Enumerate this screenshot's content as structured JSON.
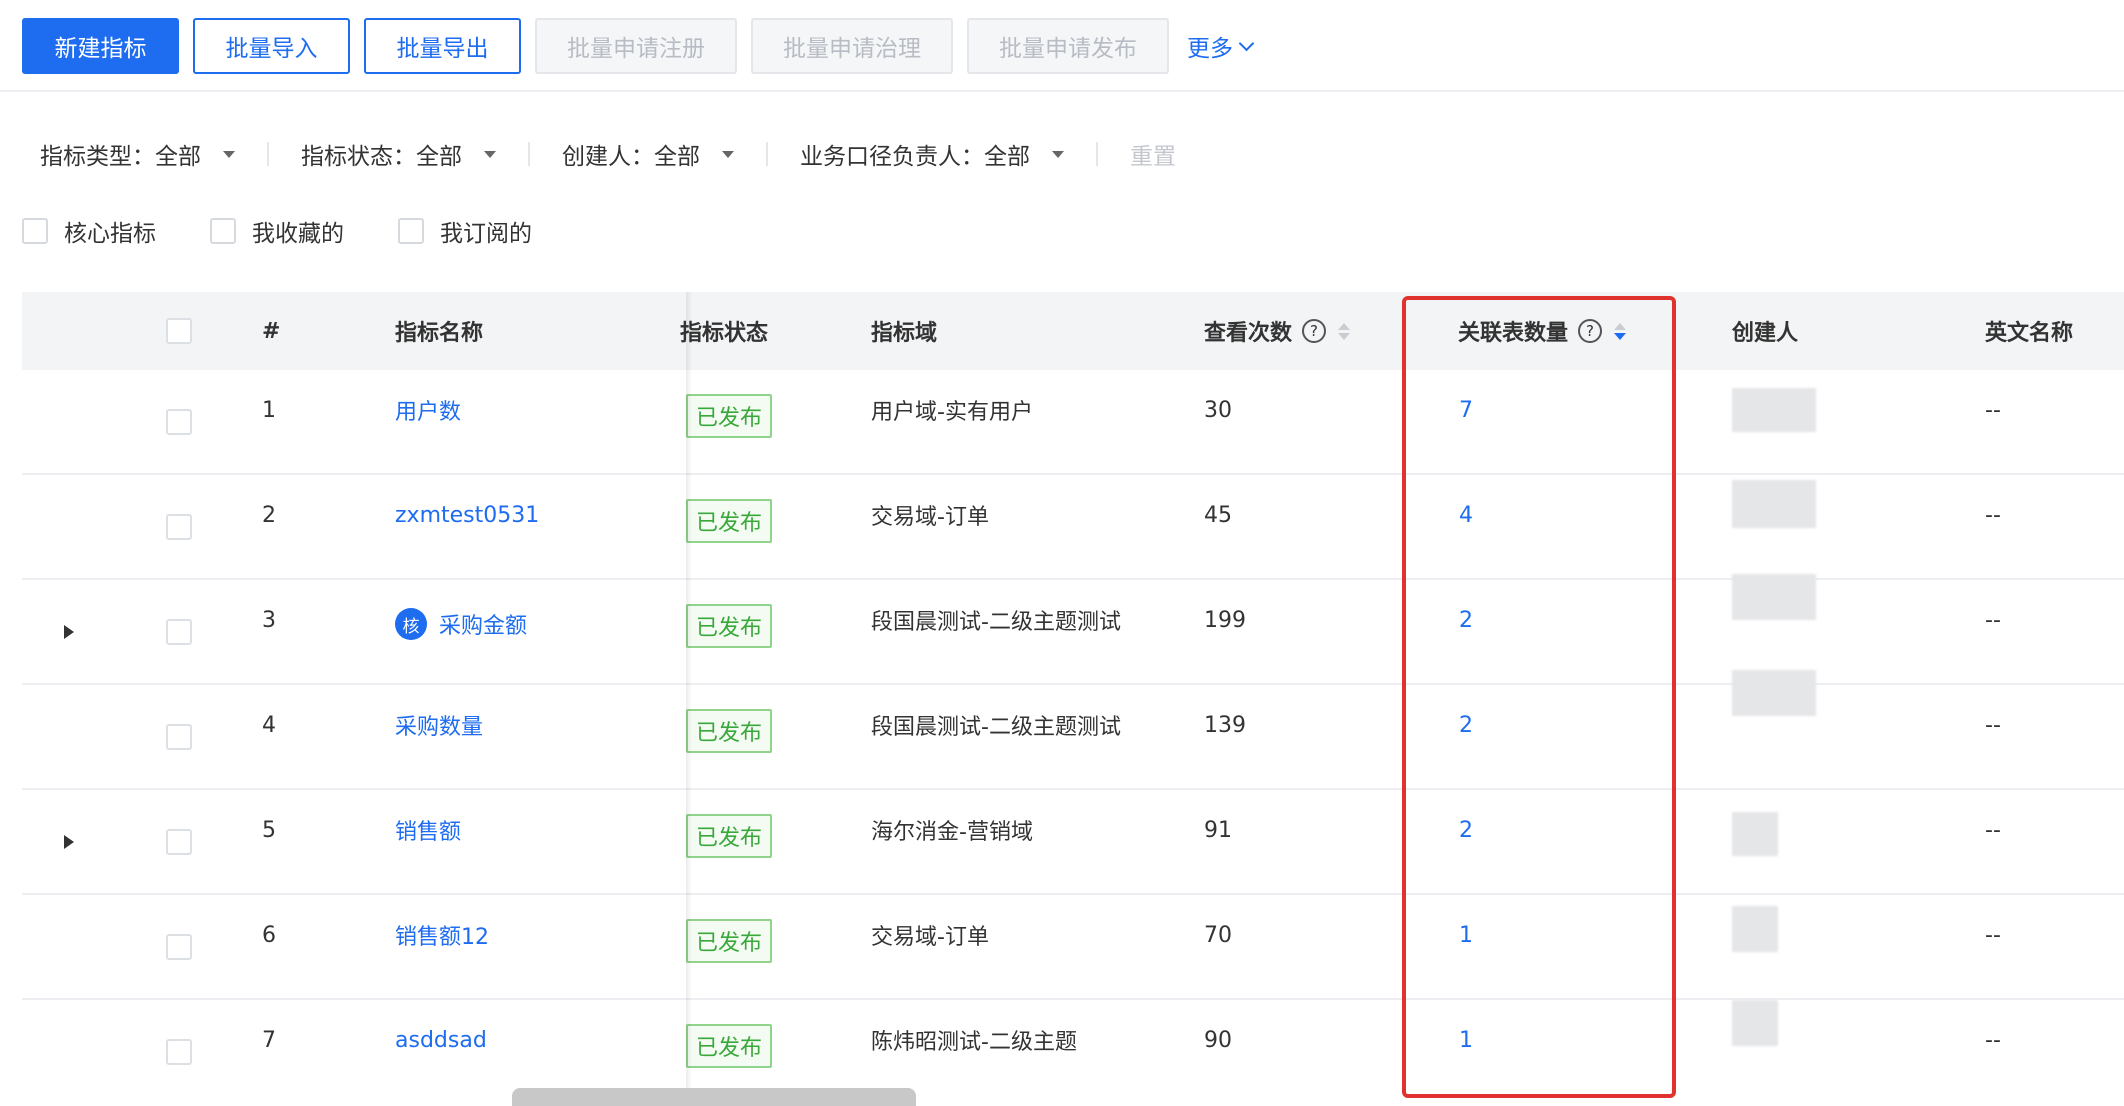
{
  "toolbar": {
    "new_metric": "新建指标",
    "batch_import": "批量导入",
    "batch_export": "批量导出",
    "batch_register": "批量申请注册",
    "batch_govern": "批量申请治理",
    "batch_publish": "批量申请发布",
    "more": "更多"
  },
  "filters": {
    "type": "指标类型：全部",
    "status": "指标状态：全部",
    "creator": "创建人：全部",
    "owner": "业务口径负责人：全部",
    "reset": "重置"
  },
  "checks": {
    "core": "核心指标",
    "favorited": "我收藏的",
    "subscribed": "我订阅的"
  },
  "columns": {
    "index": "#",
    "name": "指标名称",
    "status": "指标状态",
    "domain": "指标域",
    "views": "查看次数",
    "tables": "关联表数量",
    "creator": "创建人",
    "english": "英文名称"
  },
  "core_badge": "核",
  "rows": [
    {
      "index": "1",
      "name": "用户数",
      "status": "已发布",
      "domain": "用户域-实有用户",
      "views": "30",
      "tables": "7",
      "english": "--"
    },
    {
      "index": "2",
      "name": "zxmtest0531",
      "status": "已发布",
      "domain": "交易域-订单",
      "views": "45",
      "tables": "4",
      "english": "--"
    },
    {
      "index": "3",
      "name": "采购金额",
      "status": "已发布",
      "domain": "段国晨测试-二级主题测试",
      "views": "199",
      "tables": "2",
      "english": "--"
    },
    {
      "index": "4",
      "name": "采购数量",
      "status": "已发布",
      "domain": "段国晨测试-二级主题测试",
      "views": "139",
      "tables": "2",
      "english": "--"
    },
    {
      "index": "5",
      "name": "销售额",
      "status": "已发布",
      "domain": "海尔消金-营销域",
      "views": "91",
      "tables": "2",
      "english": "--"
    },
    {
      "index": "6",
      "name": "销售额12",
      "status": "已发布",
      "domain": "交易域-订单",
      "views": "70",
      "tables": "1",
      "english": "--"
    },
    {
      "index": "7",
      "name": "asddsad",
      "status": "已发布",
      "domain": "陈炜昭测试-二级主题",
      "views": "90",
      "tables": "1",
      "english": "--"
    }
  ],
  "colors": {
    "primary": "#1e6cf0",
    "published": "#39a83a",
    "highlight": "#e0332f"
  }
}
